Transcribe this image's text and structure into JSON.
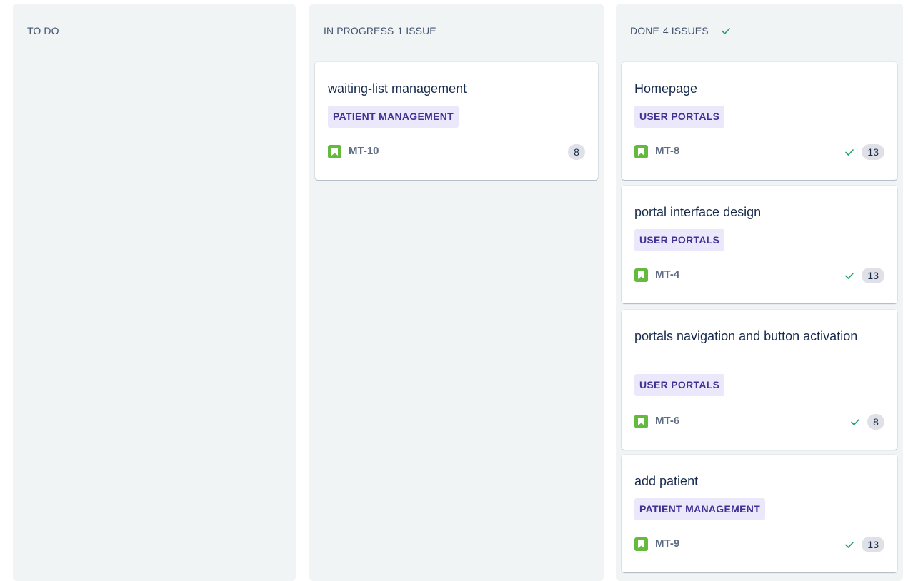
{
  "columns": {
    "todo": {
      "name": "TO DO",
      "count": ""
    },
    "in_progress": {
      "name": "IN PROGRESS",
      "count": "1 ISSUE"
    },
    "done": {
      "name": "DONE",
      "count": "4 ISSUES"
    }
  },
  "cards": {
    "in_progress": [
      {
        "title": "waiting-list management",
        "label": "PATIENT MANAGEMENT",
        "key": "MT-10",
        "points": "8",
        "done": false,
        "icon": "story-icon"
      }
    ],
    "done": [
      {
        "title": "Homepage",
        "label": "USER PORTALS",
        "key": "MT-8",
        "points": "13",
        "done": true,
        "icon": "story-icon"
      },
      {
        "title": "portal interface design",
        "label": "USER PORTALS",
        "key": "MT-4",
        "points": "13",
        "done": true,
        "icon": "story-icon"
      },
      {
        "title": "portals navigation and button activation",
        "label": "USER PORTALS",
        "key": "MT-6",
        "points": "8",
        "done": true,
        "icon": "story-icon"
      },
      {
        "title": "add patient",
        "label": "PATIENT MANAGEMENT",
        "key": "MT-9",
        "points": "13",
        "done": true,
        "icon": "story-icon"
      }
    ]
  },
  "colors": {
    "column_bg": "#f0f4f4",
    "label_bg": "#ebe8fb",
    "label_text": "#403294",
    "story_icon": "#63ba3c",
    "check": "#22a06b",
    "points_bg": "#dfe1e6"
  }
}
